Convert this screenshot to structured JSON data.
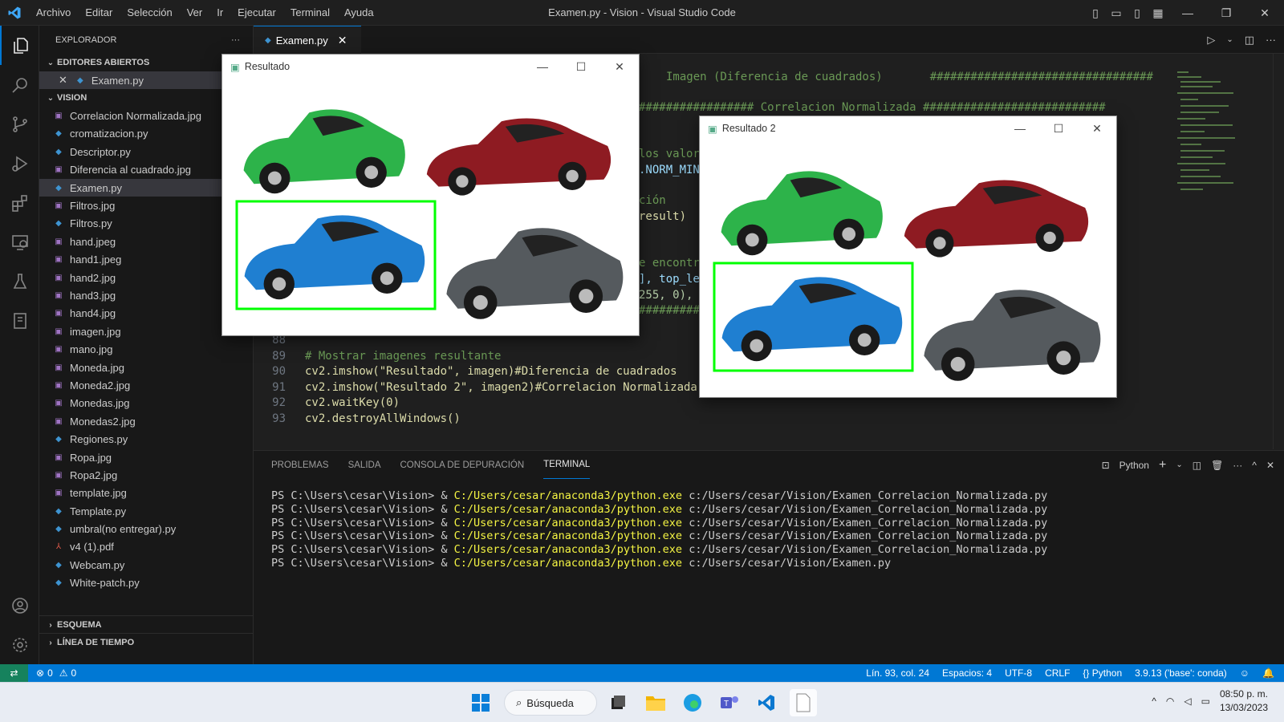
{
  "window": {
    "title": "Examen.py - Vision - Visual Studio Code",
    "menu": [
      "Archivo",
      "Editar",
      "Selección",
      "Ver",
      "Ir",
      "Ejecutar",
      "Terminal",
      "Ayuda"
    ]
  },
  "sidebar": {
    "title": "EXPLORADOR",
    "open_editors_label": "EDITORES ABIERTOS",
    "open_editor_file": "Examen.py",
    "folder_label": "VISION",
    "files": [
      {
        "name": "Correlacion Normalizada.jpg",
        "type": "img"
      },
      {
        "name": "cromatizacion.py",
        "type": "py"
      },
      {
        "name": "Descriptor.py",
        "type": "py"
      },
      {
        "name": "Diferencia al cuadrado.jpg",
        "type": "img"
      },
      {
        "name": "Examen.py",
        "type": "py"
      },
      {
        "name": "Filtros.jpg",
        "type": "img"
      },
      {
        "name": "Filtros.py",
        "type": "py"
      },
      {
        "name": "hand.jpeg",
        "type": "img"
      },
      {
        "name": "hand1.jpeg",
        "type": "img"
      },
      {
        "name": "hand2.jpg",
        "type": "img"
      },
      {
        "name": "hand3.jpg",
        "type": "img"
      },
      {
        "name": "hand4.jpg",
        "type": "img"
      },
      {
        "name": "imagen.jpg",
        "type": "img"
      },
      {
        "name": "mano.jpg",
        "type": "img"
      },
      {
        "name": "Moneda.jpg",
        "type": "img"
      },
      {
        "name": "Moneda2.jpg",
        "type": "img"
      },
      {
        "name": "Monedas.jpg",
        "type": "img"
      },
      {
        "name": "Monedas2.jpg",
        "type": "img"
      },
      {
        "name": "Regiones.py",
        "type": "py"
      },
      {
        "name": "Ropa.jpg",
        "type": "img"
      },
      {
        "name": "Ropa2.jpg",
        "type": "img"
      },
      {
        "name": "template.jpg",
        "type": "img"
      },
      {
        "name": "Template.py",
        "type": "py"
      },
      {
        "name": "umbral(no entregar).py",
        "type": "py"
      },
      {
        "name": "v4 (1).pdf",
        "type": "pdf"
      },
      {
        "name": "Webcam.py",
        "type": "py"
      },
      {
        "name": "White-patch.py",
        "type": "py"
      }
    ],
    "outline_label": "ESQUEMA",
    "timeline_label": "LÍNEA DE TIEMPO"
  },
  "editor": {
    "tab_label": "Examen.py",
    "partial_lines": [
      "Imagen (Diferencia de cuadrados)       #################################",
      "################# Correlacion Normalizada ###########################",
      "los valor",
      ".NORM_MIN",
      "ción",
      "result)",
      "e encontr",
      "], top_le",
      "255, 0),",
      "################################"
    ],
    "lines": [
      {
        "num": "88",
        "text": ""
      },
      {
        "num": "89",
        "text": "# Mostrar imagenes resultante"
      },
      {
        "num": "90",
        "text": "cv2.imshow(\"Resultado\", imagen)#Diferencia de cuadrados"
      },
      {
        "num": "91",
        "text": "cv2.imshow(\"Resultado 2\", imagen2)#Correlacion Normalizada"
      },
      {
        "num": "92",
        "text": "cv2.waitKey(0)"
      },
      {
        "num": "93",
        "text": "cv2.destroyAllWindows()"
      }
    ]
  },
  "panel": {
    "tabs": [
      "PROBLEMAS",
      "SALIDA",
      "CONSOLA DE DEPURACIÓN",
      "TERMINAL"
    ],
    "active_tab": "TERMINAL",
    "shell_label": "Python",
    "terminal_lines": [
      {
        "prompt": "PS C:\\Users\\cesar\\Vision> & ",
        "exe": "C:/Users/cesar/anaconda3/python.exe",
        "arg": " c:/Users/cesar/Vision/Examen_Correlacion_Normalizada.py"
      },
      {
        "prompt": "PS C:\\Users\\cesar\\Vision> & ",
        "exe": "C:/Users/cesar/anaconda3/python.exe",
        "arg": " c:/Users/cesar/Vision/Examen_Correlacion_Normalizada.py"
      },
      {
        "prompt": "PS C:\\Users\\cesar\\Vision> & ",
        "exe": "C:/Users/cesar/anaconda3/python.exe",
        "arg": " c:/Users/cesar/Vision/Examen_Correlacion_Normalizada.py"
      },
      {
        "prompt": "PS C:\\Users\\cesar\\Vision> & ",
        "exe": "C:/Users/cesar/anaconda3/python.exe",
        "arg": " c:/Users/cesar/Vision/Examen_Correlacion_Normalizada.py"
      },
      {
        "prompt": "PS C:\\Users\\cesar\\Vision> & ",
        "exe": "C:/Users/cesar/anaconda3/python.exe",
        "arg": " c:/Users/cesar/Vision/Examen_Correlacion_Normalizada.py"
      },
      {
        "prompt": "PS C:\\Users\\cesar\\Vision> & ",
        "exe": "C:/Users/cesar/anaconda3/python.exe",
        "arg": " c:/Users/cesar/Vision/Examen.py"
      }
    ]
  },
  "popups": [
    {
      "title": "Resultado"
    },
    {
      "title": "Resultado 2"
    }
  ],
  "statusbar": {
    "errors": "0",
    "warnings": "0",
    "position": "Lín. 93, col. 24",
    "spaces": "Espacios: 4",
    "encoding": "UTF-8",
    "eol": "CRLF",
    "language": "Python",
    "interpreter": "3.9.13 ('base': conda)"
  },
  "taskbar": {
    "search_label": "Búsqueda",
    "time": "08:50 p. m.",
    "date": "13/03/2023"
  },
  "colors": {
    "accent": "#0078d4",
    "match_box": "#00ff00",
    "cars": [
      "#2db34a",
      "#8e1b22",
      "#1f7fd1",
      "#555a5e"
    ]
  }
}
